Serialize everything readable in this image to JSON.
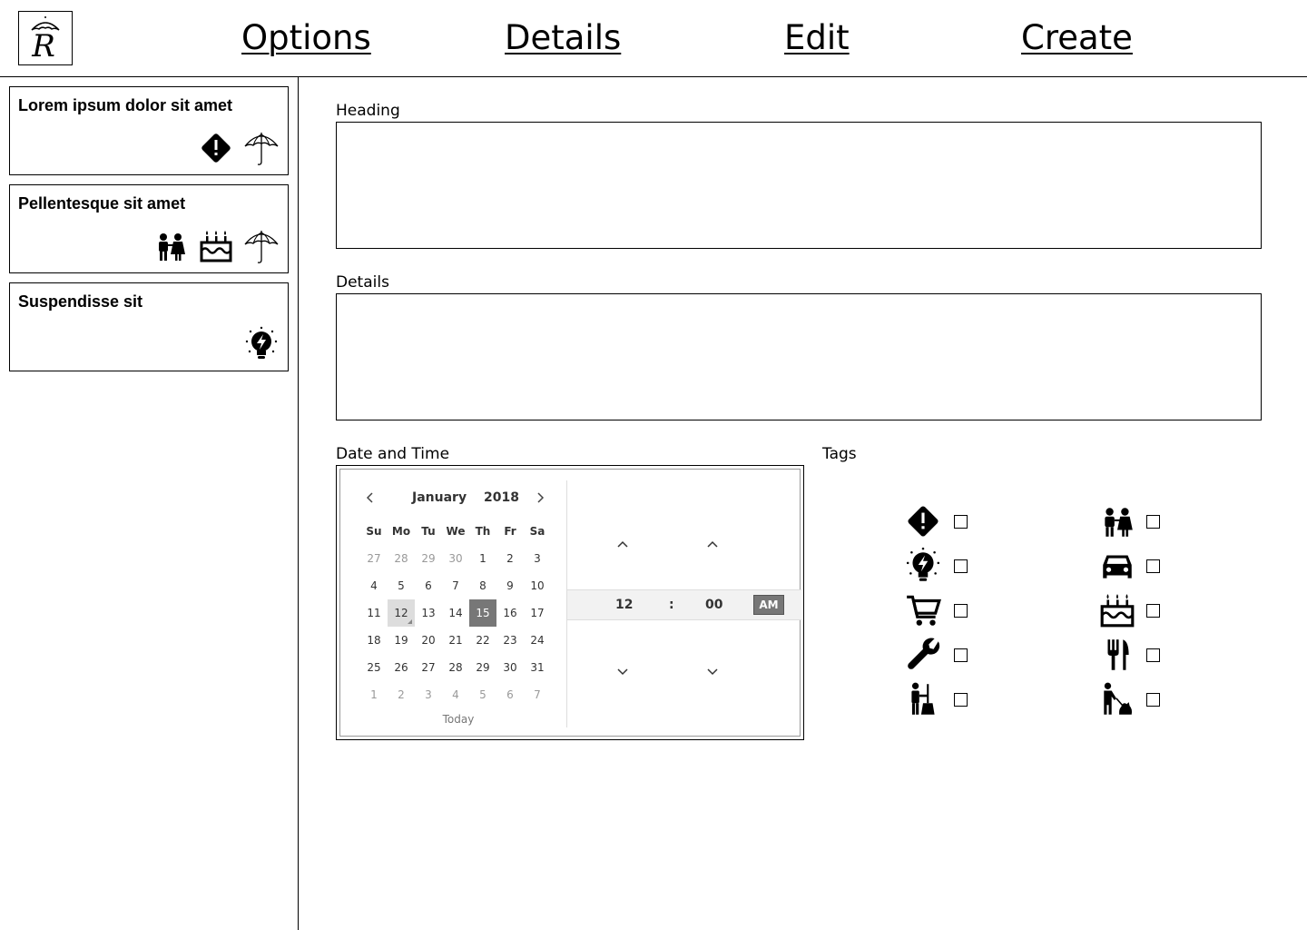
{
  "header": {
    "logo_letter": "R",
    "nav": [
      {
        "label": "Options"
      },
      {
        "label": "Details"
      },
      {
        "label": "Edit"
      },
      {
        "label": "Create"
      }
    ]
  },
  "sidebar": {
    "cards": [
      {
        "title": "Lorem ipsum dolor sit amet",
        "icons": [
          "alert-diamond-icon",
          "umbrella-icon"
        ]
      },
      {
        "title": "Pellentesque sit amet",
        "icons": [
          "family-icon",
          "birthday-cake-icon",
          "umbrella-icon"
        ]
      },
      {
        "title": "Suspendisse sit",
        "icons": [
          "lightbulb-bolt-icon"
        ]
      }
    ]
  },
  "form": {
    "heading_label": "Heading",
    "heading_value": "",
    "details_label": "Details",
    "details_value": "",
    "datetime_label": "Date and Time",
    "tags_label": "Tags"
  },
  "calendar": {
    "month": "January",
    "year": "2018",
    "weekdays": [
      "Su",
      "Mo",
      "Tu",
      "We",
      "Th",
      "Fr",
      "Sa"
    ],
    "weeks": [
      [
        "27",
        "28",
        "29",
        "30",
        "1",
        "2",
        "3"
      ],
      [
        "4",
        "5",
        "6",
        "7",
        "8",
        "9",
        "10"
      ],
      [
        "11",
        "12",
        "13",
        "14",
        "15",
        "16",
        "17"
      ],
      [
        "18",
        "19",
        "20",
        "21",
        "22",
        "23",
        "24"
      ],
      [
        "25",
        "26",
        "27",
        "28",
        "29",
        "30",
        "31"
      ],
      [
        "1",
        "2",
        "3",
        "4",
        "5",
        "6",
        "7"
      ]
    ],
    "selected_day": "15",
    "hovered_day": "12",
    "today_label": "Today"
  },
  "time": {
    "hour": "12",
    "separator": ":",
    "minute": "00",
    "period": "AM"
  },
  "tags": [
    {
      "icon": "alert-diamond-icon",
      "checked": false
    },
    {
      "icon": "family-icon",
      "checked": false
    },
    {
      "icon": "lightbulb-bolt-icon",
      "checked": false
    },
    {
      "icon": "car-icon",
      "checked": false
    },
    {
      "icon": "shopping-cart-icon",
      "checked": false
    },
    {
      "icon": "birthday-cake-icon",
      "checked": false
    },
    {
      "icon": "wrench-icon",
      "checked": false
    },
    {
      "icon": "fork-knife-icon",
      "checked": false
    },
    {
      "icon": "cleaning-icon",
      "checked": false
    },
    {
      "icon": "dog-walking-icon",
      "checked": false
    }
  ]
}
